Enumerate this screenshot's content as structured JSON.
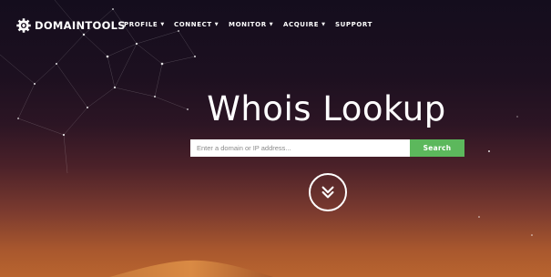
{
  "brand": {
    "name": "DOMAINTOOLS",
    "logo_icon": "domaintools-gear-icon"
  },
  "nav": {
    "items": [
      {
        "label": "PROFILE",
        "has_dropdown": true
      },
      {
        "label": "CONNECT",
        "has_dropdown": true
      },
      {
        "label": "MONITOR",
        "has_dropdown": true
      },
      {
        "label": "ACQUIRE",
        "has_dropdown": true
      },
      {
        "label": "SUPPORT",
        "has_dropdown": false
      }
    ],
    "dropdown_icon": "caret-down-icon"
  },
  "hero": {
    "title": "Whois Lookup"
  },
  "search": {
    "value": "",
    "placeholder": "Enter a domain or IP address...",
    "button_label": "Search",
    "button_color": "#5cb85c"
  },
  "scroll": {
    "icon": "double-chevron-down-icon"
  },
  "colors": {
    "sky_top": "#140d1d",
    "horizon": "#b9652f",
    "text": "#ffffff"
  }
}
